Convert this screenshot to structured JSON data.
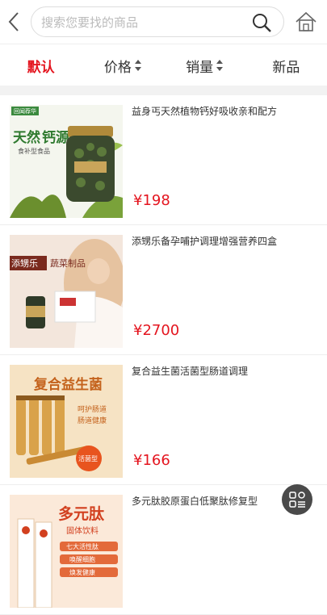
{
  "header": {
    "search_placeholder": "搜索您要找的商品"
  },
  "tabs": [
    {
      "label": "默认"
    },
    {
      "label": "价格"
    },
    {
      "label": "销量"
    },
    {
      "label": "新品"
    }
  ],
  "colors": {
    "accent": "#e4151f",
    "divider": "#f2f2f2"
  },
  "products": [
    {
      "title": "益身丐天然植物钙好吸收亲和配方",
      "price": "¥198",
      "image": {
        "badge": "回闻荐华",
        "line1": "天然",
        "line2": "钙源",
        "sub": "食补型食品"
      }
    },
    {
      "title": "添甥乐备孕哺护调理增强营养四盒",
      "price": "¥2700",
      "image": {
        "brand": "添甥乐",
        "sub": "蔬菜制品"
      }
    },
    {
      "title": "复合益生菌活菌型肠道调理",
      "price": "¥166",
      "image": {
        "headline": "复合益生菌",
        "tag1": "呵护肠道",
        "tag2": "肠道健康",
        "burst": "活菌型"
      }
    },
    {
      "title": "多元肽胶原蛋白低聚肽修复型",
      "price": "",
      "image": {
        "headline": "多元肽",
        "sub": "固体饮料",
        "tag1": "七大活性肽",
        "tag2": "唤醒细胞",
        "tag3": "焕发健康"
      }
    }
  ],
  "icons": {
    "back": "chevron-left-icon",
    "search": "magnifier-icon",
    "home": "home-icon",
    "float": "menu-grid-icon"
  }
}
